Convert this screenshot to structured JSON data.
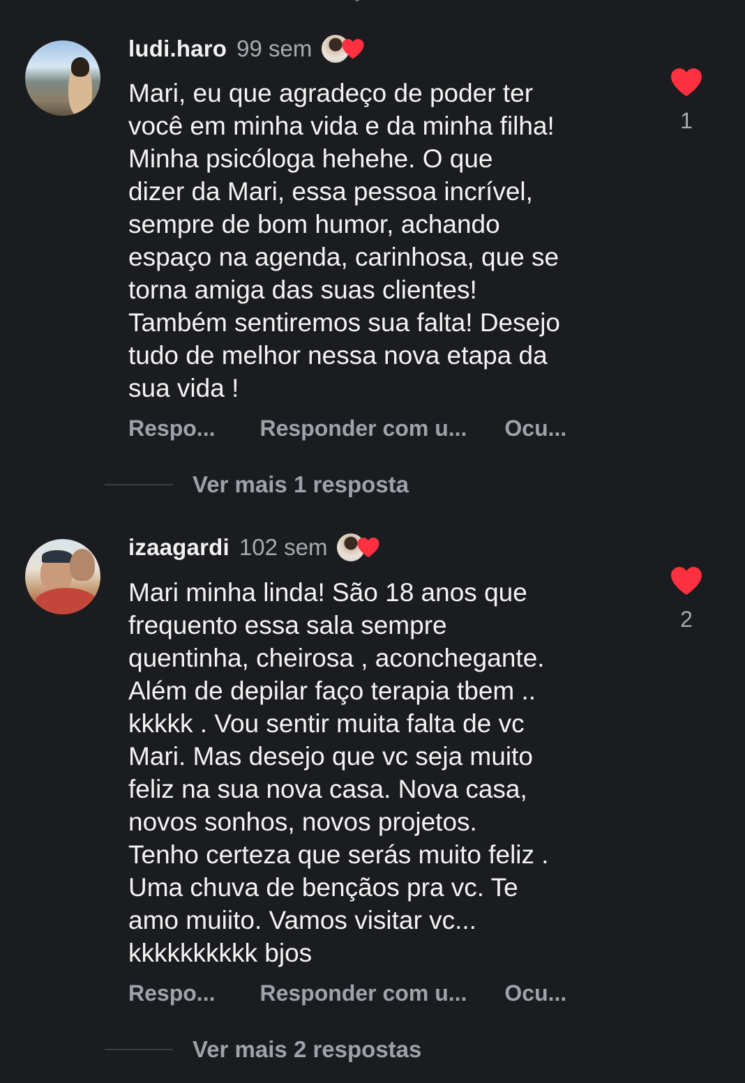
{
  "comments": [
    {
      "username": "ludi.haro",
      "time": "99 sem",
      "text": "Mari, eu que agradeço de poder ter\nvocê em minha vida e da minha filha!\nMinha psicóloga hehehe. O que\ndizer da Mari, essa pessoa incrível,\nsempre de bom humor, achando\nespaço na agenda, carinhosa, que se\ntorna amiga das suas clientes!\nTambém sentiremos sua falta! Desejo\ntudo de melhor nessa nova etapa da\nsua vida !",
      "like_count": "1",
      "actions": {
        "reply": "Respo...",
        "reply_with": "Responder com u...",
        "hide": "Ocu..."
      },
      "more_replies": "Ver mais 1 resposta"
    },
    {
      "username": "izaagardi",
      "time": "102 sem",
      "text": "Mari minha linda! São 18 anos que\nfrequento essa sala sempre\nquentinha, cheirosa , aconchegante.\nAlém de depilar faço terapia tbem ..\nkkkkk . Vou sentir muita falta de vc\nMari. Mas desejo que vc seja muito\nfeliz na sua nova casa. Nova casa,\nnovos sonhos, novos projetos.\nTenho certeza que serás muito feliz .\nUma chuva de bençãos pra vc. Te\namo muiito. Vamos visitar vc...\nkkkkkkkkkk bjos",
      "like_count": "2",
      "actions": {
        "reply": "Respo...",
        "reply_with": "Responder com u...",
        "hide": "Ocu..."
      },
      "more_replies": "Ver mais 2 respostas"
    }
  ],
  "icons": {
    "like": "heart-icon",
    "author_like": "author-liked-heart-icon"
  },
  "colors": {
    "background": "#1a1c1f",
    "heart": "#ff3040",
    "muted": "#9ea3aa"
  }
}
